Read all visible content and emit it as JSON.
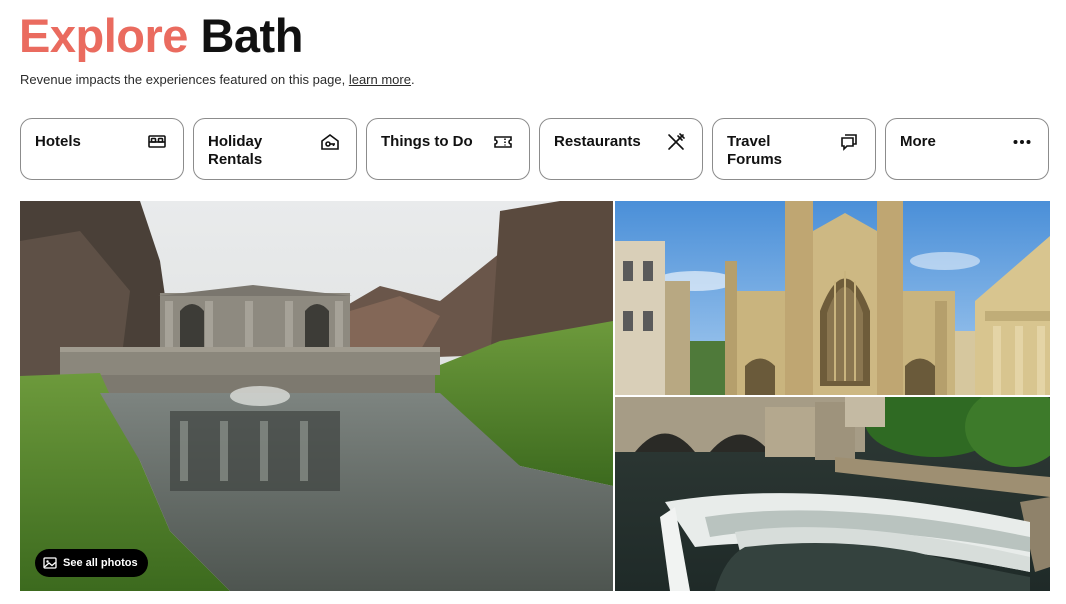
{
  "header": {
    "title_accent": "Explore",
    "title_place": "Bath",
    "accent_color": "#ea6b5f"
  },
  "disclaimer": {
    "text": "Revenue impacts the experiences featured on this page, ",
    "link": "learn more",
    "suffix": "."
  },
  "categories": [
    {
      "label": "Hotels",
      "icon": "bed-icon"
    },
    {
      "label": "Holiday Rentals",
      "icon": "house-key-icon"
    },
    {
      "label": "Things to Do",
      "icon": "ticket-icon"
    },
    {
      "label": "Restaurants",
      "icon": "fork-knife-icon"
    },
    {
      "label": "Travel Forums",
      "icon": "chat-bubbles-icon"
    },
    {
      "label": "More",
      "icon": "more-dots-icon"
    }
  ],
  "gallery": {
    "see_all_label": "See all photos",
    "see_all_icon": "image-icon"
  }
}
